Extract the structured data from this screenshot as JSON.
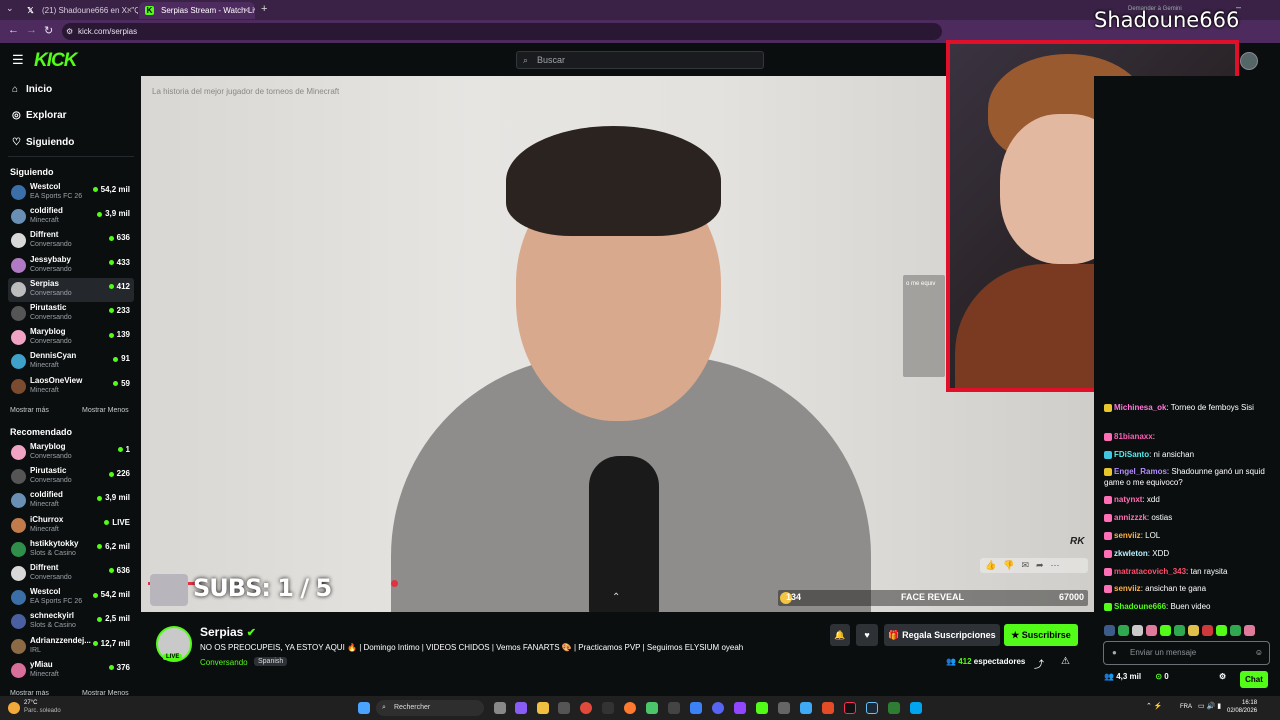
{
  "browser": {
    "tabs": [
      {
        "title": "(21) Shadoune666 en X: \"Que c",
        "icon": "x-icon"
      },
      {
        "title": "Serpias Stream - Watch Liv",
        "icon": "kick-icon"
      }
    ],
    "url": "kick.com/serpias"
  },
  "header": {
    "logo": "KICK",
    "search_placeholder": "Buscar"
  },
  "sidebar": {
    "nav": [
      {
        "label": "Inicio",
        "icon": "home-icon"
      },
      {
        "label": "Explorar",
        "icon": "compass-icon"
      },
      {
        "label": "Siguiendo",
        "icon": "heart-icon"
      }
    ],
    "following_title": "Siguiendo",
    "following": [
      {
        "name": "Westcol",
        "game": "EA Sports FC 26",
        "viewers": "54,2 mil",
        "color": "#3b6fa8"
      },
      {
        "name": "coldified",
        "game": "Minecraft",
        "viewers": "3,9 mil",
        "color": "#6a8fb5"
      },
      {
        "name": "Diffrent",
        "game": "Conversando",
        "viewers": "636",
        "color": "#d8d8d8"
      },
      {
        "name": "Jessybaby",
        "game": "Conversando",
        "viewers": "433",
        "color": "#b07ac4"
      },
      {
        "name": "Serpias",
        "game": "Conversando",
        "viewers": "412",
        "color": "#bdbdbd"
      },
      {
        "name": "Pirutastic",
        "game": "Conversando",
        "viewers": "233",
        "color": "#555"
      },
      {
        "name": "Maryblog",
        "game": "Conversando",
        "viewers": "139",
        "color": "#f0a3c2"
      },
      {
        "name": "DennisCyan",
        "game": "Minecraft",
        "viewers": "91",
        "color": "#3fa1c9"
      },
      {
        "name": "LaosOneView",
        "game": "Minecraft",
        "viewers": "59",
        "color": "#7a4b2e"
      }
    ],
    "show_more": "Mostrar más",
    "show_less": "Mostrar Menos",
    "recommended_title": "Recomendado",
    "recommended": [
      {
        "name": "Maryblog",
        "game": "Conversando",
        "viewers": "1",
        "color": "#f0a3c2"
      },
      {
        "name": "Pirutastic",
        "game": "Conversando",
        "viewers": "226",
        "color": "#555"
      },
      {
        "name": "coldified",
        "game": "Minecraft",
        "viewers": "3,9 mil",
        "color": "#6a8fb5"
      },
      {
        "name": "iChurrox",
        "game": "Minecraft",
        "viewers": "LIVE",
        "color": "#c27b4b"
      },
      {
        "name": "hstikkytokky",
        "game": "Slots & Casino",
        "viewers": "6,2 mil",
        "color": "#2f8f4a"
      },
      {
        "name": "Diffrent",
        "game": "Conversando",
        "viewers": "636",
        "color": "#d8d8d8"
      },
      {
        "name": "Westcol",
        "game": "EA Sports FC 26",
        "viewers": "54,2 mil",
        "color": "#3b6fa8"
      },
      {
        "name": "schneckyirl",
        "game": "Slots & Casino",
        "viewers": "2,5 mil",
        "color": "#4a5fa0"
      },
      {
        "name": "Adrianzzendej...",
        "game": "IRL",
        "viewers": "12,7 mil",
        "color": "#8b6a45"
      },
      {
        "name": "yMiau",
        "game": "Minecraft",
        "viewers": "376",
        "color": "#d86f9a"
      }
    ]
  },
  "video": {
    "overlay_title": "La historia del mejor jugador de torneos de Minecraft",
    "subs_text": "SUBS: 1 / 5",
    "subs_progress": 0.2,
    "face_reveal_left": "134",
    "face_reveal_label": "FACE REVEAL",
    "face_reveal_right": "67000",
    "watermark": "RK"
  },
  "webcam": {
    "name": "Shadoune666",
    "gemini_label": "Demander à Gemini"
  },
  "stream": {
    "name": "Serpias",
    "live_badge": "LIVE",
    "title": "NO OS PREOCUPEIS, YA ESTOY AQUI 🔥 | Domingo Intimo | VIDEOS CHIDOS | Vemos FANARTS 🎨 | Practicamos PVP | Seguimos ELYSIUM oyeah",
    "category": "Conversando",
    "language": "Spanish",
    "gift_label": "Regala Suscripciones",
    "subscribe_label": "Suscribirse",
    "viewers": "412",
    "viewers_label": "espectadores"
  },
  "chat": {
    "messages": [
      {
        "user": "Michinesa_ok",
        "text": ": Torneo de femboys Sisi",
        "color": "#ff7ad9",
        "badge": "#e8c72c"
      },
      {
        "user": "81bianaxx",
        "text": ":",
        "color": "#ff5cb8",
        "badge": "#ff6fb5"
      },
      {
        "user": "FDiSanto",
        "text": ": ni ansichan",
        "color": "#52f0f0",
        "badge": "#3fc6e0"
      },
      {
        "user": "Engel_Ramos",
        "text": ": Shadounne ganó un squid game o me equivoco?",
        "color": "#b48cff",
        "badge": "#e8c72c"
      },
      {
        "user": "natynxt",
        "text": ": xdd",
        "color": "#ff6fb5",
        "badge": "#ff6fb5"
      },
      {
        "user": "annizzzk",
        "text": ": ostias",
        "color": "#ff6fb5",
        "badge": "#ff6fb5"
      },
      {
        "user": "senviiz",
        "text": ": LOL",
        "color": "#ffb347",
        "badge": "#ff6fb5"
      },
      {
        "user": "zkwleton",
        "text": ": XDD",
        "color": "#b7f0ff",
        "badge": "#ff6fb5"
      },
      {
        "user": "matratacovich_343",
        "text": ": tan raysita",
        "color": "#ff4d6d",
        "badge": "#ff6fb5"
      },
      {
        "user": "senviiz",
        "text": ": ansichan te gana",
        "color": "#ffb347",
        "badge": "#ff6fb5"
      },
      {
        "user": "Shadoune666",
        "text": ": Buen video",
        "color": "#53fc18",
        "badge": "#53fc18"
      }
    ],
    "input_placeholder": "Enviar un mensaje",
    "followers": "4,3 mil",
    "points": "0",
    "chat_button": "Chat"
  },
  "taskbar": {
    "weather_temp": "27°C",
    "weather_desc": "Parc. soleado",
    "search_label": "Rechercher",
    "language": "FRA",
    "time": "16:18",
    "date": "02/08/2026"
  }
}
